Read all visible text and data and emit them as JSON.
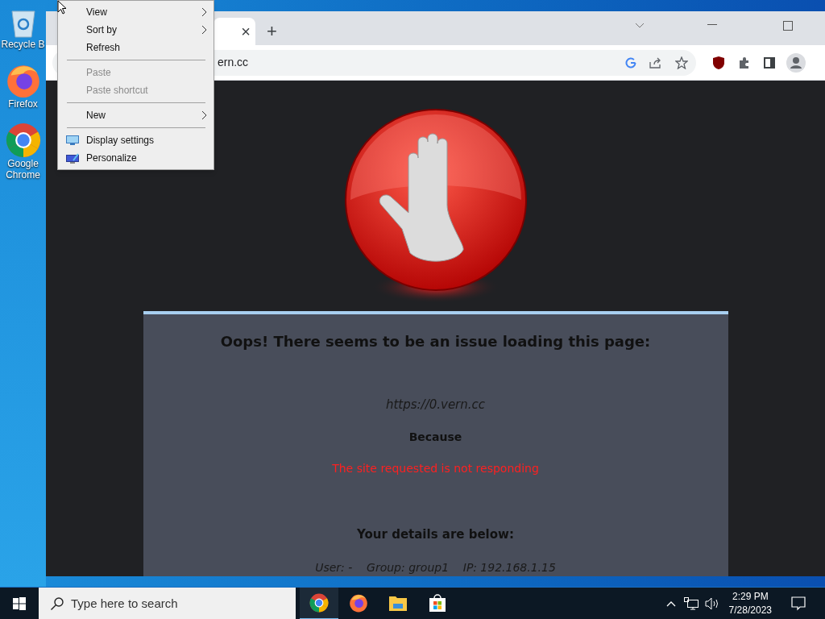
{
  "desktop_icons": [
    {
      "label": "Recycle B",
      "kind": "bin"
    },
    {
      "label": "Firefox",
      "kind": "firefox"
    },
    {
      "label": "Google Chrome",
      "kind": "chrome"
    }
  ],
  "browser": {
    "tab_close": "×",
    "new_tab": "+",
    "address": "ern.cc"
  },
  "error_page": {
    "heading": "Oops! There seems to be an issue loading this page:",
    "url": "https://0.vern.cc",
    "because": "Because",
    "reason": "The site requested is not responding",
    "details_heading": "Your details are below:",
    "details": "User: -    Group: group1    IP: 192.168.1.15"
  },
  "context_menu": [
    {
      "kind": "item",
      "label": "View",
      "submenu": true,
      "disabled": false
    },
    {
      "kind": "item",
      "label": "Sort by",
      "submenu": true,
      "disabled": false
    },
    {
      "kind": "item",
      "label": "Refresh",
      "submenu": false,
      "disabled": false
    },
    {
      "kind": "separator"
    },
    {
      "kind": "item",
      "label": "Paste",
      "submenu": false,
      "disabled": true
    },
    {
      "kind": "item",
      "label": "Paste shortcut",
      "submenu": false,
      "disabled": true
    },
    {
      "kind": "separator"
    },
    {
      "kind": "item",
      "label": "New",
      "submenu": true,
      "disabled": false
    },
    {
      "kind": "separator"
    },
    {
      "kind": "monitor_item",
      "label": "Display settings",
      "submenu": false,
      "disabled": false
    },
    {
      "kind": "brush_item",
      "label": "Personalize",
      "submenu": false,
      "disabled": false
    }
  ],
  "taskbar": {
    "search_placeholder": "Type here to search",
    "apps": [
      {
        "kind": "chrome",
        "selected": true
      },
      {
        "kind": "firefox",
        "selected": false
      },
      {
        "kind": "folder",
        "selected": false
      },
      {
        "kind": "store",
        "selected": false
      }
    ],
    "time": "2:29 PM",
    "date": "7/28/2023"
  }
}
